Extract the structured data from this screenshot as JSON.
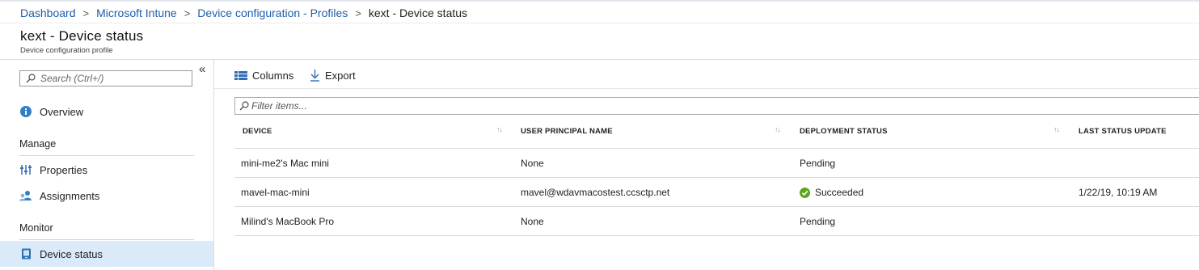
{
  "breadcrumb": {
    "items": [
      "Dashboard",
      "Microsoft Intune",
      "Device configuration - Profiles"
    ],
    "current": "kext - Device status",
    "separator": ">"
  },
  "header": {
    "title": "kext - Device status",
    "subtitle": "Device configuration profile"
  },
  "sidebar": {
    "collapse_glyph": "«",
    "search_placeholder": "Search (Ctrl+/)",
    "overview_label": "Overview",
    "sections": [
      {
        "heading": "Manage",
        "items": [
          "Properties",
          "Assignments"
        ]
      },
      {
        "heading": "Monitor",
        "items": [
          "Device status"
        ]
      }
    ],
    "selected_item": "Device status"
  },
  "toolbar": {
    "columns_label": "Columns",
    "export_label": "Export"
  },
  "filter": {
    "placeholder": "Filter items..."
  },
  "table": {
    "columns": [
      "DEVICE",
      "USER PRINCIPAL NAME",
      "DEPLOYMENT STATUS",
      "LAST STATUS UPDATE"
    ],
    "sort_glyph": "↑↓",
    "rows": [
      {
        "device": "mini-me2's Mac mini",
        "upn": "None",
        "status": "Pending",
        "last_update": ""
      },
      {
        "device": "mavel-mac-mini",
        "upn": "mavel@wdavmacostest.ccsctp.net",
        "status": "Succeeded",
        "last_update": "1/22/19, 10:19 AM"
      },
      {
        "device": "Milind's MacBook Pro",
        "upn": "None",
        "status": "Pending",
        "last_update": ""
      }
    ]
  },
  "colors": {
    "link": "#1f5ea8",
    "accent": "#0078d4",
    "success": "#5ea51e",
    "selected_bg": "#dbeaf8"
  },
  "icons": {
    "overview": "info-icon",
    "properties": "properties-bars-icon",
    "assignments": "users-icon",
    "device_status": "device-status-icon",
    "columns": "columns-grid-icon",
    "export": "download-icon",
    "succeeded": "check-circle-icon"
  }
}
